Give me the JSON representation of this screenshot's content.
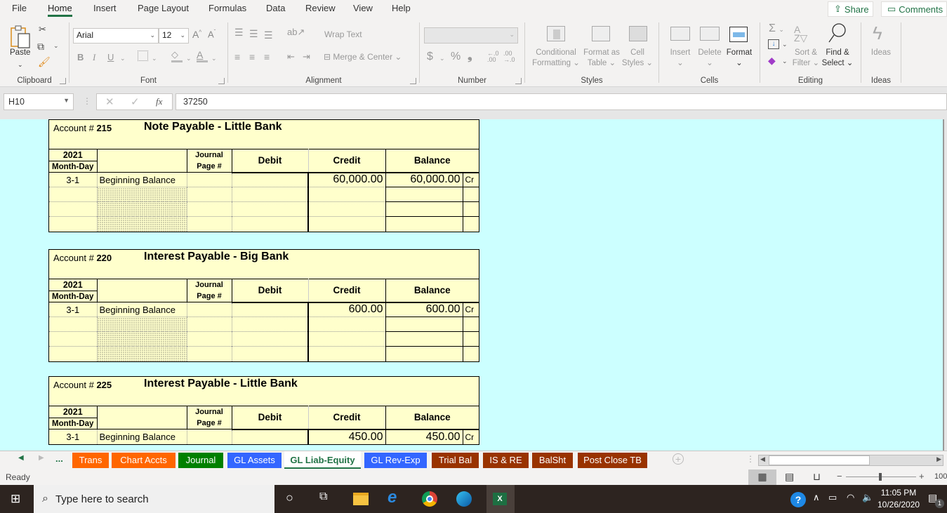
{
  "menu": {
    "tabs": [
      "File",
      "Home",
      "Insert",
      "Page Layout",
      "Formulas",
      "Data",
      "Review",
      "View",
      "Help"
    ],
    "active": "Home",
    "share": "Share",
    "comments": "Comments"
  },
  "ribbon": {
    "clipboard": {
      "label": "Clipboard",
      "paste": "Paste"
    },
    "font": {
      "label": "Font",
      "name": "Arial",
      "size": "12",
      "bold": "B",
      "italic": "I",
      "underline": "U"
    },
    "alignment": {
      "label": "Alignment",
      "wrap": "Wrap Text",
      "merge": "Merge & Center"
    },
    "number": {
      "label": "Number",
      "format": "",
      "currency": "$",
      "percent": "%",
      "comma": "9",
      "inc_dec": "←.0 .00",
      "dec_dec": ".00 →.0"
    },
    "styles": {
      "label": "Styles",
      "conditional": [
        "Conditional",
        "Formatting"
      ],
      "format_table": [
        "Format as",
        "Table"
      ],
      "cell_styles": [
        "Cell",
        "Styles"
      ]
    },
    "cells": {
      "label": "Cells",
      "insert": "Insert",
      "delete": "Delete",
      "format": "Format"
    },
    "editing": {
      "label": "Editing",
      "sort": [
        "Sort &",
        "Filter"
      ],
      "find": [
        "Find &",
        "Select"
      ]
    },
    "ideas": {
      "label": "Ideas",
      "button": "Ideas"
    }
  },
  "formula_bar": {
    "cell_ref": "H10",
    "value": "37250",
    "fx": "fx"
  },
  "sheet": {
    "headers": {
      "year": "2021",
      "month_day": "Month-Day",
      "journal": "Journal",
      "page": "Page #",
      "debit": "Debit",
      "credit": "Credit",
      "balance": "Balance"
    },
    "account_prefix": "Account #",
    "accounts": [
      {
        "number": "215",
        "name": "Note Payable - Little Bank",
        "rows": [
          {
            "date": "3-1",
            "desc": "Beginning Balance",
            "jp": "",
            "debit": "",
            "credit": "60,000.00",
            "balance": "60,000.00",
            "crdr": "Cr"
          }
        ]
      },
      {
        "number": "220",
        "name": "Interest Payable - Big Bank",
        "rows": [
          {
            "date": "3-1",
            "desc": "Beginning Balance",
            "jp": "",
            "debit": "",
            "credit": "600.00",
            "balance": "600.00",
            "crdr": "Cr"
          }
        ]
      },
      {
        "number": "225",
        "name": "Interest Payable - Little Bank",
        "rows": [
          {
            "date": "3-1",
            "desc": "Beginning Balance",
            "jp": "",
            "debit": "",
            "credit": "450.00",
            "balance": "450.00",
            "crdr": "Cr"
          }
        ]
      }
    ]
  },
  "sheet_tabs": [
    {
      "label": "Trans",
      "color": "#ff6600"
    },
    {
      "label": "Chart Accts",
      "color": "#ff6600"
    },
    {
      "label": "Journal",
      "color": "#008000"
    },
    {
      "label": "GL Assets",
      "color": "#3366ff"
    },
    {
      "label": "GL Liab-Equity",
      "color": "#ffffff",
      "active": true
    },
    {
      "label": "GL Rev-Exp",
      "color": "#3366ff"
    },
    {
      "label": "Trial Bal",
      "color": "#993300"
    },
    {
      "label": "IS & RE",
      "color": "#993300"
    },
    {
      "label": "BalSht",
      "color": "#993300"
    },
    {
      "label": "Post Close TB",
      "color": "#993300"
    }
  ],
  "tab_nav": {
    "more": "..."
  },
  "status": {
    "text": "Ready",
    "zoom": "100"
  },
  "taskbar": {
    "search_placeholder": "Type here to search",
    "time": "11:05 PM",
    "date": "10/26/2020",
    "notifications": "1"
  }
}
